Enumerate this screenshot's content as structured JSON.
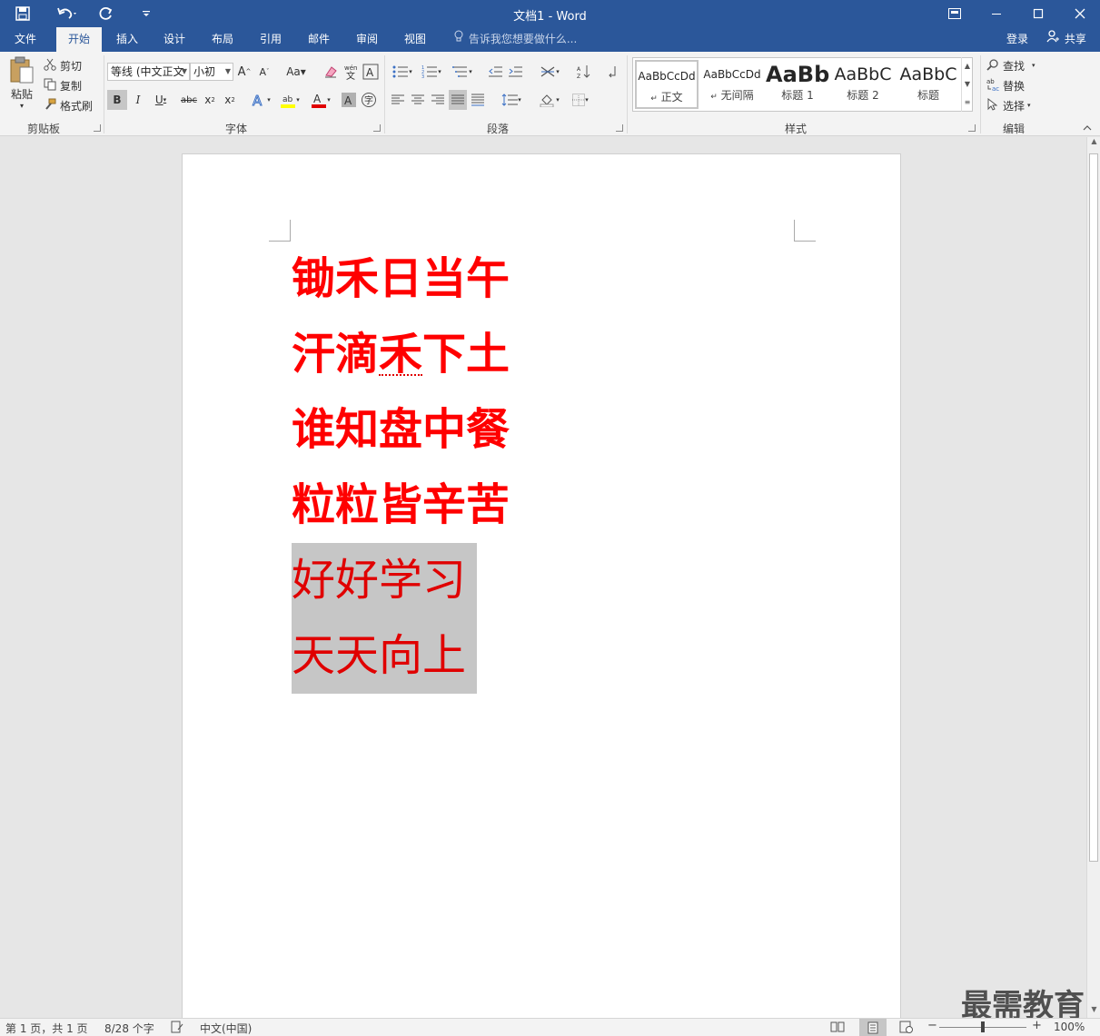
{
  "window": {
    "title": "文档1 - Word"
  },
  "qat": {
    "save_icon": "save-icon",
    "undo_icon": "undo-icon",
    "redo_icon": "redo-icon",
    "customize_icon": "customize-qat-icon"
  },
  "tabs": [
    {
      "label": "文件"
    },
    {
      "label": "开始"
    },
    {
      "label": "插入"
    },
    {
      "label": "设计"
    },
    {
      "label": "布局"
    },
    {
      "label": "引用"
    },
    {
      "label": "邮件"
    },
    {
      "label": "审阅"
    },
    {
      "label": "视图"
    }
  ],
  "tellme": {
    "placeholder": "告诉我您想要做什么..."
  },
  "account": {
    "login": "登录",
    "share": "共享"
  },
  "clipboard": {
    "paste": "粘贴",
    "cut": "剪切",
    "copy": "复制",
    "format_painter": "格式刷",
    "group": "剪贴板"
  },
  "font": {
    "name": "等线 (中文正文",
    "size": "小初",
    "group": "字体"
  },
  "paragraph": {
    "group": "段落"
  },
  "styles": {
    "group": "样式",
    "items": [
      {
        "preview": "AaBbCcDd",
        "name": "正文"
      },
      {
        "preview": "AaBbCcDd",
        "name": "无间隔"
      },
      {
        "preview": "AaBb",
        "name": "标题 1"
      },
      {
        "preview": "AaBbC",
        "name": "标题 2"
      },
      {
        "preview": "AaBbC",
        "name": "标题"
      }
    ]
  },
  "editing": {
    "find": "查找",
    "replace": "替换",
    "select": "选择",
    "group": "编辑"
  },
  "document": {
    "lines": [
      "锄禾日当午",
      "汗滴禾下土",
      "谁知盘中餐",
      "粒粒皆辛苦",
      "好好学习",
      "天天向上"
    ],
    "text_color": "#ff0000",
    "selection_color": "#c6c6c6"
  },
  "status": {
    "page": "第 1 页，共 1 页",
    "words": "8/28 个字",
    "language": "中文(中国)",
    "zoom": "100%",
    "zoom_level": 1.0
  },
  "watermark": "最需教育"
}
